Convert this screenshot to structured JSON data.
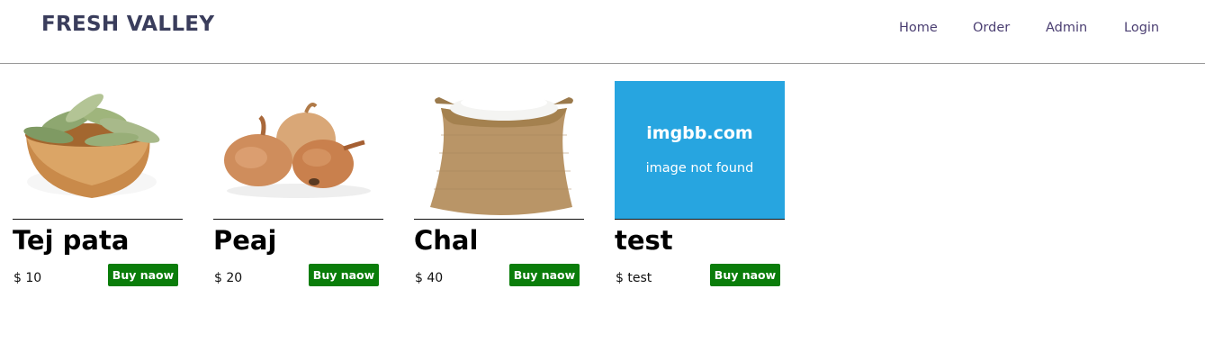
{
  "header": {
    "brand": "FRESH VALLEY",
    "nav": [
      {
        "label": "Home"
      },
      {
        "label": "Order"
      },
      {
        "label": "Admin"
      },
      {
        "label": "Login"
      }
    ]
  },
  "products": [
    {
      "name": "Tej pata",
      "price": "$ 10",
      "button": "Buy naow",
      "image": "bay-leaves-bowl-image"
    },
    {
      "name": "Peaj",
      "price": "$ 20",
      "button": "Buy naow",
      "image": "onions-image"
    },
    {
      "name": "Chal",
      "price": "$ 40",
      "button": "Buy naow",
      "image": "rice-sack-image"
    },
    {
      "name": "test",
      "price": "$ test",
      "button": "Buy naow",
      "image": "image-not-found-placeholder",
      "placeholder": {
        "line1": "imgbb.com",
        "line2": "image not found"
      }
    }
  ],
  "colors": {
    "brand": "#3a3d5c",
    "nav_link": "#4b3f72",
    "buy_button": "#0a7d0a",
    "placeholder_bg": "#27a5e0"
  }
}
